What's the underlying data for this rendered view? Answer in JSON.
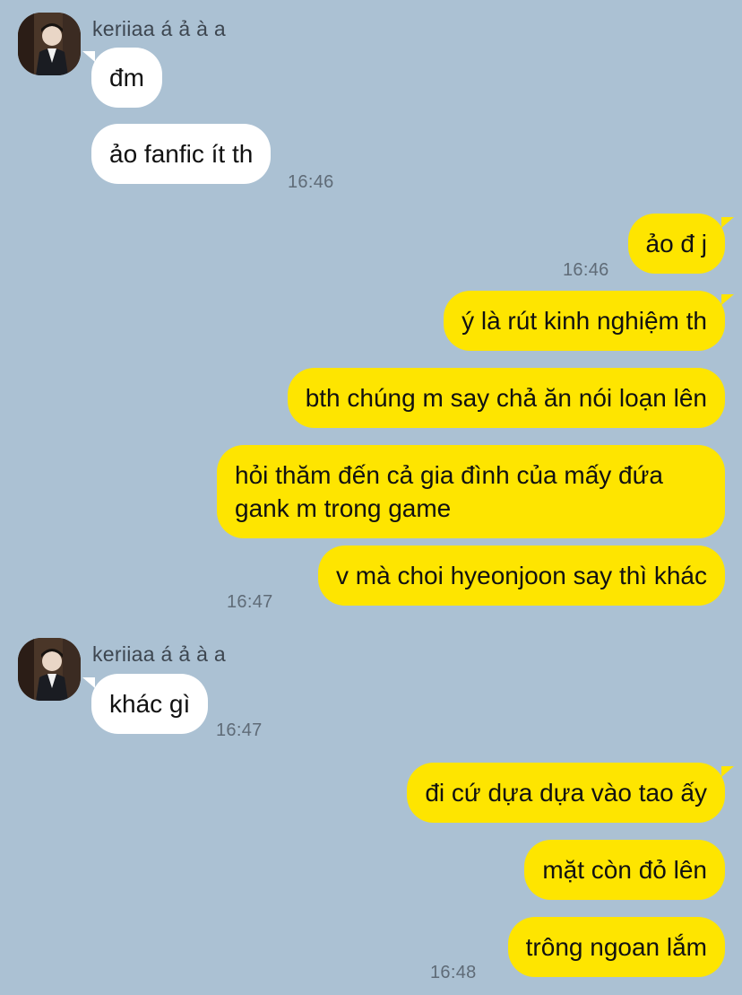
{
  "colors": {
    "background": "#abc1d3",
    "incoming_bubble": "#ffffff",
    "outgoing_bubble": "#fee500",
    "text": "#111111",
    "timestamp": "#5f6b77"
  },
  "groups": [
    {
      "sender": "keriiaa á ả à a",
      "avatar": "profile-photo",
      "messages": [
        {
          "text": "đm"
        },
        {
          "text": "ảo fanfic ít th",
          "time": "16:46"
        }
      ]
    },
    {
      "sender": "me",
      "messages": [
        {
          "text": "ảo đ j",
          "time": "16:46"
        },
        {
          "text": "ý là rút kinh nghiệm th"
        },
        {
          "text": "bth chúng m say chả ăn nói loạn lên"
        },
        {
          "text": "hỏi thăm đến cả gia đình của mấy đứa gank m trong game"
        },
        {
          "text": "v mà choi hyeonjoon say thì khác",
          "time": "16:47"
        }
      ]
    },
    {
      "sender": "keriiaa á ả à a",
      "avatar": "profile-photo",
      "messages": [
        {
          "text": "khác gì",
          "time": "16:47"
        }
      ]
    },
    {
      "sender": "me",
      "messages": [
        {
          "text": "đi cứ dựa dựa vào tao ấy"
        },
        {
          "text": "mặt còn đỏ lên"
        },
        {
          "text": "trông ngoan lắm",
          "time": "16:48"
        }
      ]
    }
  ]
}
